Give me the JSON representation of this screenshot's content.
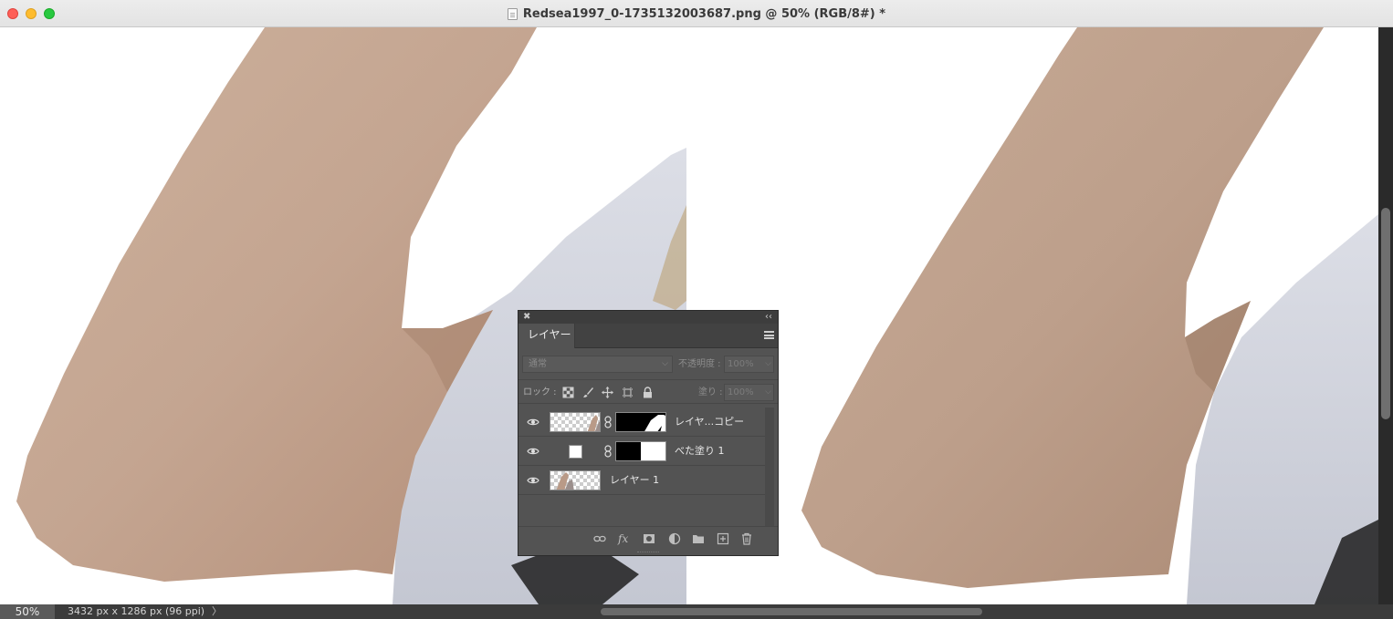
{
  "window": {
    "title": "Redsea1997_0-1735132003687.png @ 50% (RGB/8#) *"
  },
  "status": {
    "zoom": "50%",
    "doc_info": "3432 px x 1286 px (96 ppi)",
    "arrow": "〉"
  },
  "layers_panel": {
    "tab_label": "レイヤー",
    "blend_mode": "通常",
    "opacity_label": "不透明度 :",
    "opacity_value": "100%",
    "lock_label": "ロック :",
    "fill_label": "塗り :",
    "fill_value": "100%",
    "layers": [
      {
        "name": "レイヤ...コピー",
        "visible": true
      },
      {
        "name": "べた塗り 1",
        "visible": true
      },
      {
        "name": "レイヤー 1",
        "visible": true
      }
    ]
  },
  "colors": {
    "skin": "#c8a58f",
    "shirt": "#cfd2dc",
    "panel_bg": "#535353",
    "statusbar": "#3b3b3b"
  },
  "icons": {
    "close": "close-icon",
    "collapse": "double-chevron-left-icon",
    "menu": "hamburger-menu-icon",
    "eye": "eye-icon",
    "link": "chain-link-icon"
  }
}
